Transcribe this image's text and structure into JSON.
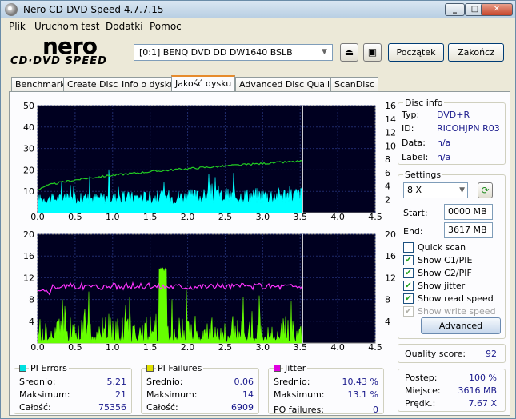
{
  "window": {
    "title": "Nero CD-DVD Speed 4.7.7.15"
  },
  "menu": [
    "Plik",
    "Uruchom test",
    "Dodatki",
    "Pomoc"
  ],
  "logo": {
    "brand": "nero",
    "sub": "CD·DVD SPEED"
  },
  "drive": {
    "selected": "[0:1]   BENQ DVD DD DW1640 BSLB"
  },
  "buttons": {
    "start": "Początek",
    "stop": "Zakończ"
  },
  "tabs": [
    "Benchmark",
    "Create Disc",
    "Info o dysku",
    "Jakość dysku",
    "Advanced Disc Quality",
    "ScanDisc"
  ],
  "active_tab": 3,
  "disc_info": {
    "title": "Disc info",
    "type_label": "Typ:",
    "type_value": "DVD+R",
    "id_label": "ID:",
    "id_value": "RICOHJPN R03",
    "date_label": "Data:",
    "date_value": "n/a",
    "label_label": "Label:",
    "label_value": "n/a"
  },
  "settings": {
    "title": "Settings",
    "speed": "8 X",
    "start_label": "Start:",
    "start_value": "0000 MB",
    "end_label": "End:",
    "end_value": "3617 MB",
    "options": [
      {
        "label": "Quick scan",
        "checked": false,
        "enabled": true
      },
      {
        "label": "Show C1/PIE",
        "checked": true,
        "enabled": true
      },
      {
        "label": "Show C2/PIF",
        "checked": true,
        "enabled": true
      },
      {
        "label": "Show jitter",
        "checked": true,
        "enabled": true
      },
      {
        "label": "Show read speed",
        "checked": true,
        "enabled": true
      },
      {
        "label": "Show write speed",
        "checked": true,
        "enabled": false
      }
    ],
    "advanced_button": "Advanced"
  },
  "quality": {
    "label": "Quality score:",
    "value": "92"
  },
  "progress": {
    "postep_label": "Postep:",
    "postep_value": "100 %",
    "miejsce_label": "Miejsce:",
    "miejsce_value": "3616 MB",
    "predk_label": "Prędk.:",
    "predk_value": "7.67 X"
  },
  "pi_errors": {
    "title": "PI Errors",
    "color": "#00e0e0",
    "avg_label": "Średnio:",
    "avg": "5.21",
    "max_label": "Maksimum:",
    "max": "21",
    "total_label": "Całość:",
    "total": "75356"
  },
  "pi_failures": {
    "title": "PI Failures",
    "color": "#e0e000",
    "avg_label": "Średnio:",
    "avg": "0.06",
    "max_label": "Maksimum:",
    "max": "14",
    "total_label": "Całość:",
    "total": "6909"
  },
  "jitter": {
    "title": "Jitter",
    "color": "#e000e0",
    "avg_label": "Średnio:",
    "avg": "10.43 %",
    "max_label": "Maksimum:",
    "max": "13.1 %",
    "po_label": "PO failures:",
    "po": "0"
  },
  "chart_data": [
    {
      "type": "area",
      "x_ticks": [
        "0.0",
        "0.5",
        "1.0",
        "1.5",
        "2.0",
        "2.5",
        "3.0",
        "3.5",
        "4.0",
        "4.5"
      ],
      "y_left_ticks": [
        "50",
        "40",
        "30",
        "20",
        "10"
      ],
      "y_right_ticks": [
        "16",
        "14",
        "12",
        "10",
        "8",
        "6",
        "4",
        "2"
      ],
      "xlim": [
        0,
        4.5
      ],
      "ylim": [
        0,
        50
      ],
      "y2lim": [
        0,
        16
      ],
      "end_marker_x": 3.53,
      "series": [
        {
          "values_desc": "PI errors",
          "color": "#00ffff",
          "x_end": 3.53,
          "typical": [
            4,
            12
          ],
          "peak": 21
        },
        {
          "values_desc": "read speed",
          "color": "#22cc22",
          "start": 3.2,
          "end": 7.7
        }
      ]
    },
    {
      "type": "area",
      "x_ticks": [
        "0.0",
        "0.5",
        "1.0",
        "1.5",
        "2.0",
        "2.5",
        "3.0",
        "3.5",
        "4.0",
        "4.5"
      ],
      "y_left_ticks": [
        "20",
        "16",
        "12",
        "8",
        "4"
      ],
      "y_right_ticks": [
        "20",
        "16",
        "12",
        "8",
        "4"
      ],
      "xlim": [
        0,
        4.5
      ],
      "ylim": [
        0,
        20
      ],
      "y2lim": [
        0,
        20
      ],
      "end_marker_x": 3.53,
      "series": [
        {
          "values_desc": "PI failures",
          "color": "#66ff00",
          "x_end": 3.53,
          "typical": [
            1,
            5
          ],
          "peak": 14
        },
        {
          "values_desc": "jitter",
          "color": "#ff33ff",
          "level": 10.43
        }
      ]
    }
  ]
}
